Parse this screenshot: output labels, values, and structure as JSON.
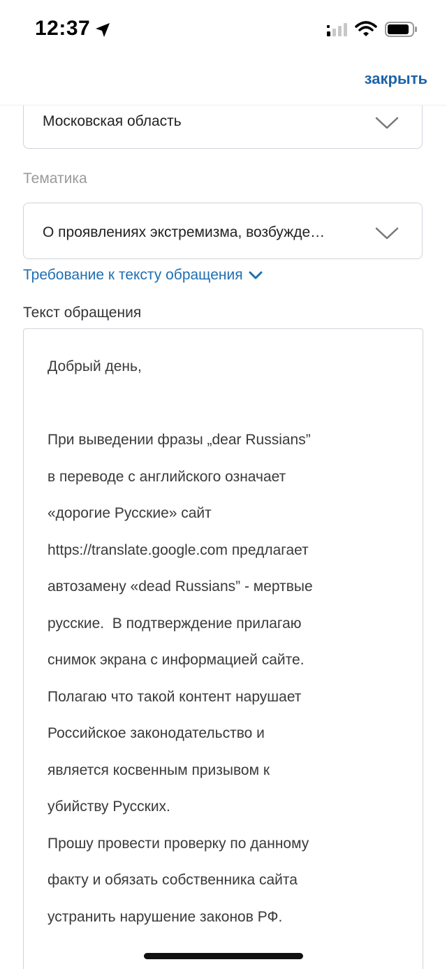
{
  "status_bar": {
    "time": "12:37",
    "location_icon": "location-arrow-icon",
    "signal_icon": "cellular-signal-icon",
    "wifi_icon": "wifi-icon",
    "battery_icon": "battery-icon"
  },
  "nav": {
    "close_label": "закрыть"
  },
  "form": {
    "region_value": "Московская область",
    "topic_label": "Тематика",
    "topic_value": "О проявлениях экстремизма, возбужде…",
    "requirements_link": "Требование к тексту обращения",
    "text_label": "Текст обращения",
    "message_text": "Добрый день,\n\nПри выведении фразы „dear Russians”\nв переводе с английского означает\n«дорогие Русские» сайт\nhttps://translate.google.com предлагает\nавтозамену «dead Russians” - мертвые\nрусские.  В подтверждение прилагаю\nснимок экрана с информацией сайте.\nПолагаю что такой контент нарушает\nРоссийское законодательство и\nявляется косвенным призывом к\nубийству Русских.\nПрошу провести проверку по данному\nфакту и обязать собственника сайта\nустранить нарушение законов РФ."
  },
  "colors": {
    "accent": "#1d63a8",
    "link": "#1f6fb2",
    "border": "#cfd4da"
  }
}
